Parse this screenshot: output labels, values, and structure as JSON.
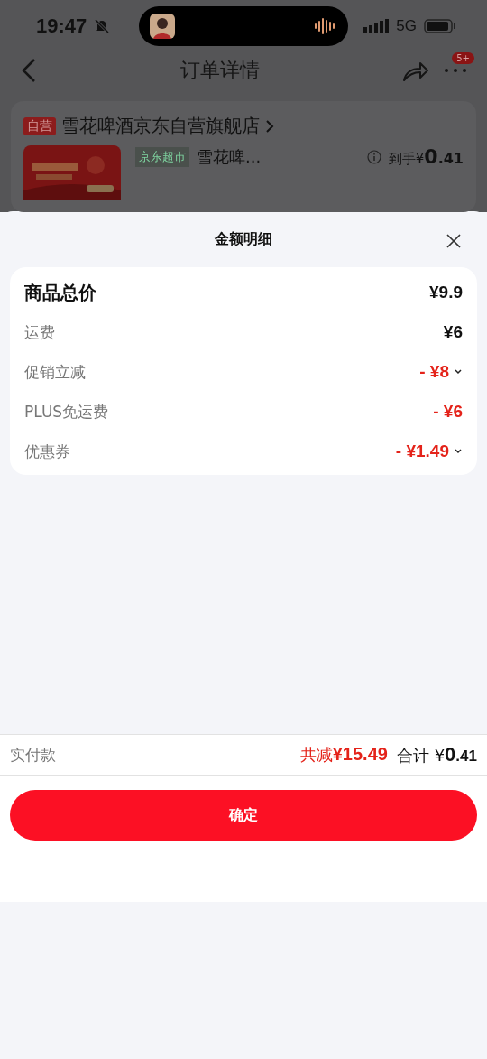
{
  "status_bar": {
    "time": "19:47",
    "network": "5G"
  },
  "nav": {
    "title": "订单详情",
    "badge": "5+"
  },
  "store": {
    "tag": "自营",
    "name": "雪花啤酒京东自营旗舰店",
    "product_tag": "京东超市",
    "product_name": "雪花啤...",
    "price_label": "到手",
    "price_currency": "¥",
    "price_int": "0",
    "price_frac": ".41"
  },
  "sheet": {
    "title": "金额明细",
    "rows": [
      {
        "kind": "total",
        "label": "商品总价",
        "value": "¥9.9",
        "discount": false,
        "expandable": false
      },
      {
        "kind": "item",
        "label": "运费",
        "value": "¥6",
        "discount": false,
        "expandable": false
      },
      {
        "kind": "item",
        "label": "促销立减",
        "value": "- ¥8",
        "discount": true,
        "expandable": true
      },
      {
        "kind": "item",
        "label": "PLUS免运费",
        "value": "- ¥6",
        "discount": true,
        "expandable": false
      },
      {
        "kind": "item",
        "label": "优惠券",
        "value": "- ¥1.49",
        "discount": true,
        "expandable": true
      }
    ]
  },
  "footer": {
    "label": "实付款",
    "saved_label": "共减",
    "saved_value": "¥15.49",
    "total_label": "合计",
    "total_currency": "¥",
    "total_int": "0",
    "total_frac": ".41"
  },
  "confirm_button": "确定"
}
